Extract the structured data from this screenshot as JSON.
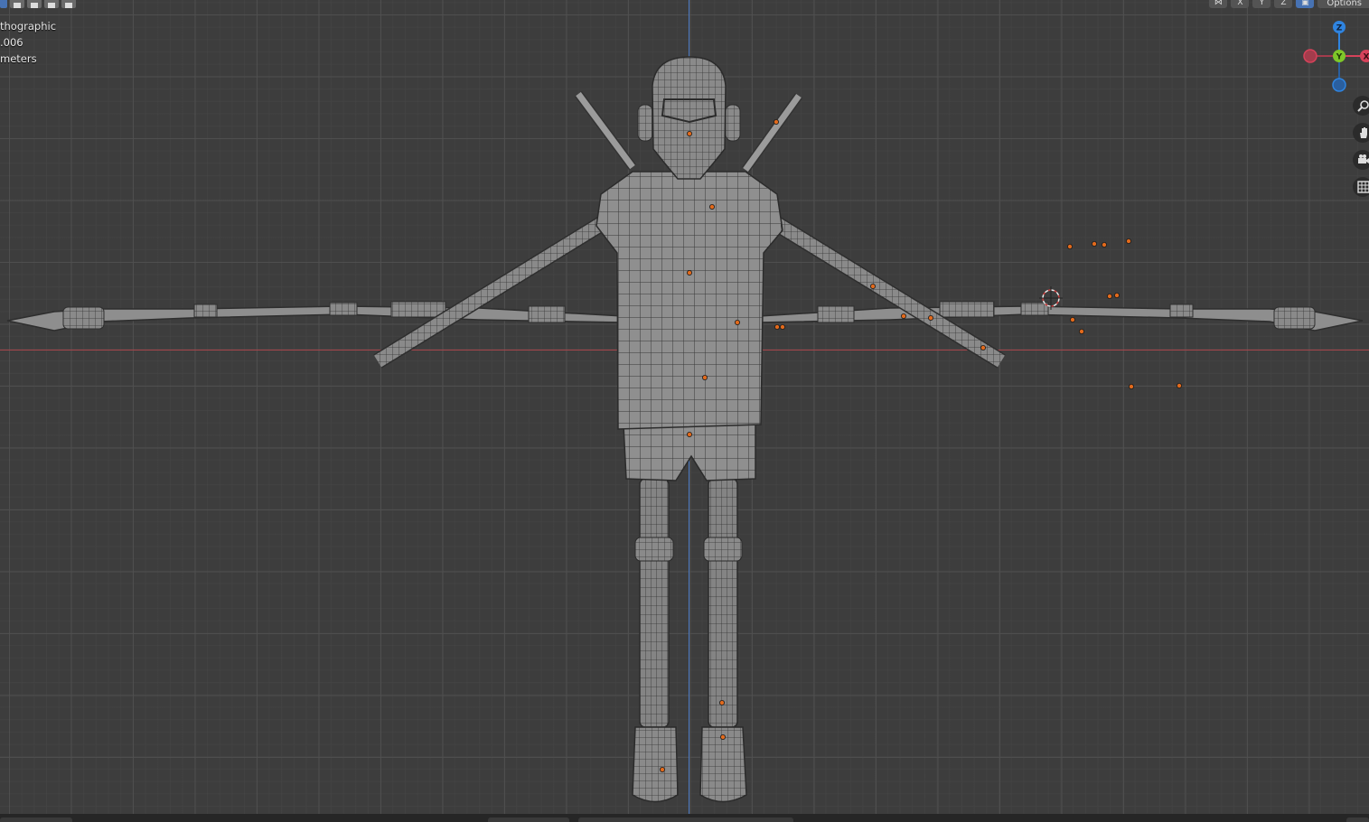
{
  "overlay": {
    "view_mode": "thographic",
    "collection_info": ".006",
    "units": "meters"
  },
  "header": {
    "axis_lock_labels": [
      "X",
      "Y",
      "Z"
    ],
    "options_label": "Options"
  },
  "gizmo": {
    "z_label": "Z",
    "y_label": "Y",
    "x_label": "X"
  },
  "nav_icons": [
    "zoom-icon",
    "pan-hand-icon",
    "camera-icon",
    "grid-perspective-icon"
  ],
  "colors": {
    "viewport_bg": "#3d3d3d",
    "x_axis": "#a8464c",
    "z_axis": "#4b79c2",
    "gizmo_x": "#d5425a",
    "gizmo_y": "#7ec829",
    "gizmo_z": "#2f84e0",
    "origin_dots": "#e26a1c",
    "mesh": "#9a9a9a"
  }
}
